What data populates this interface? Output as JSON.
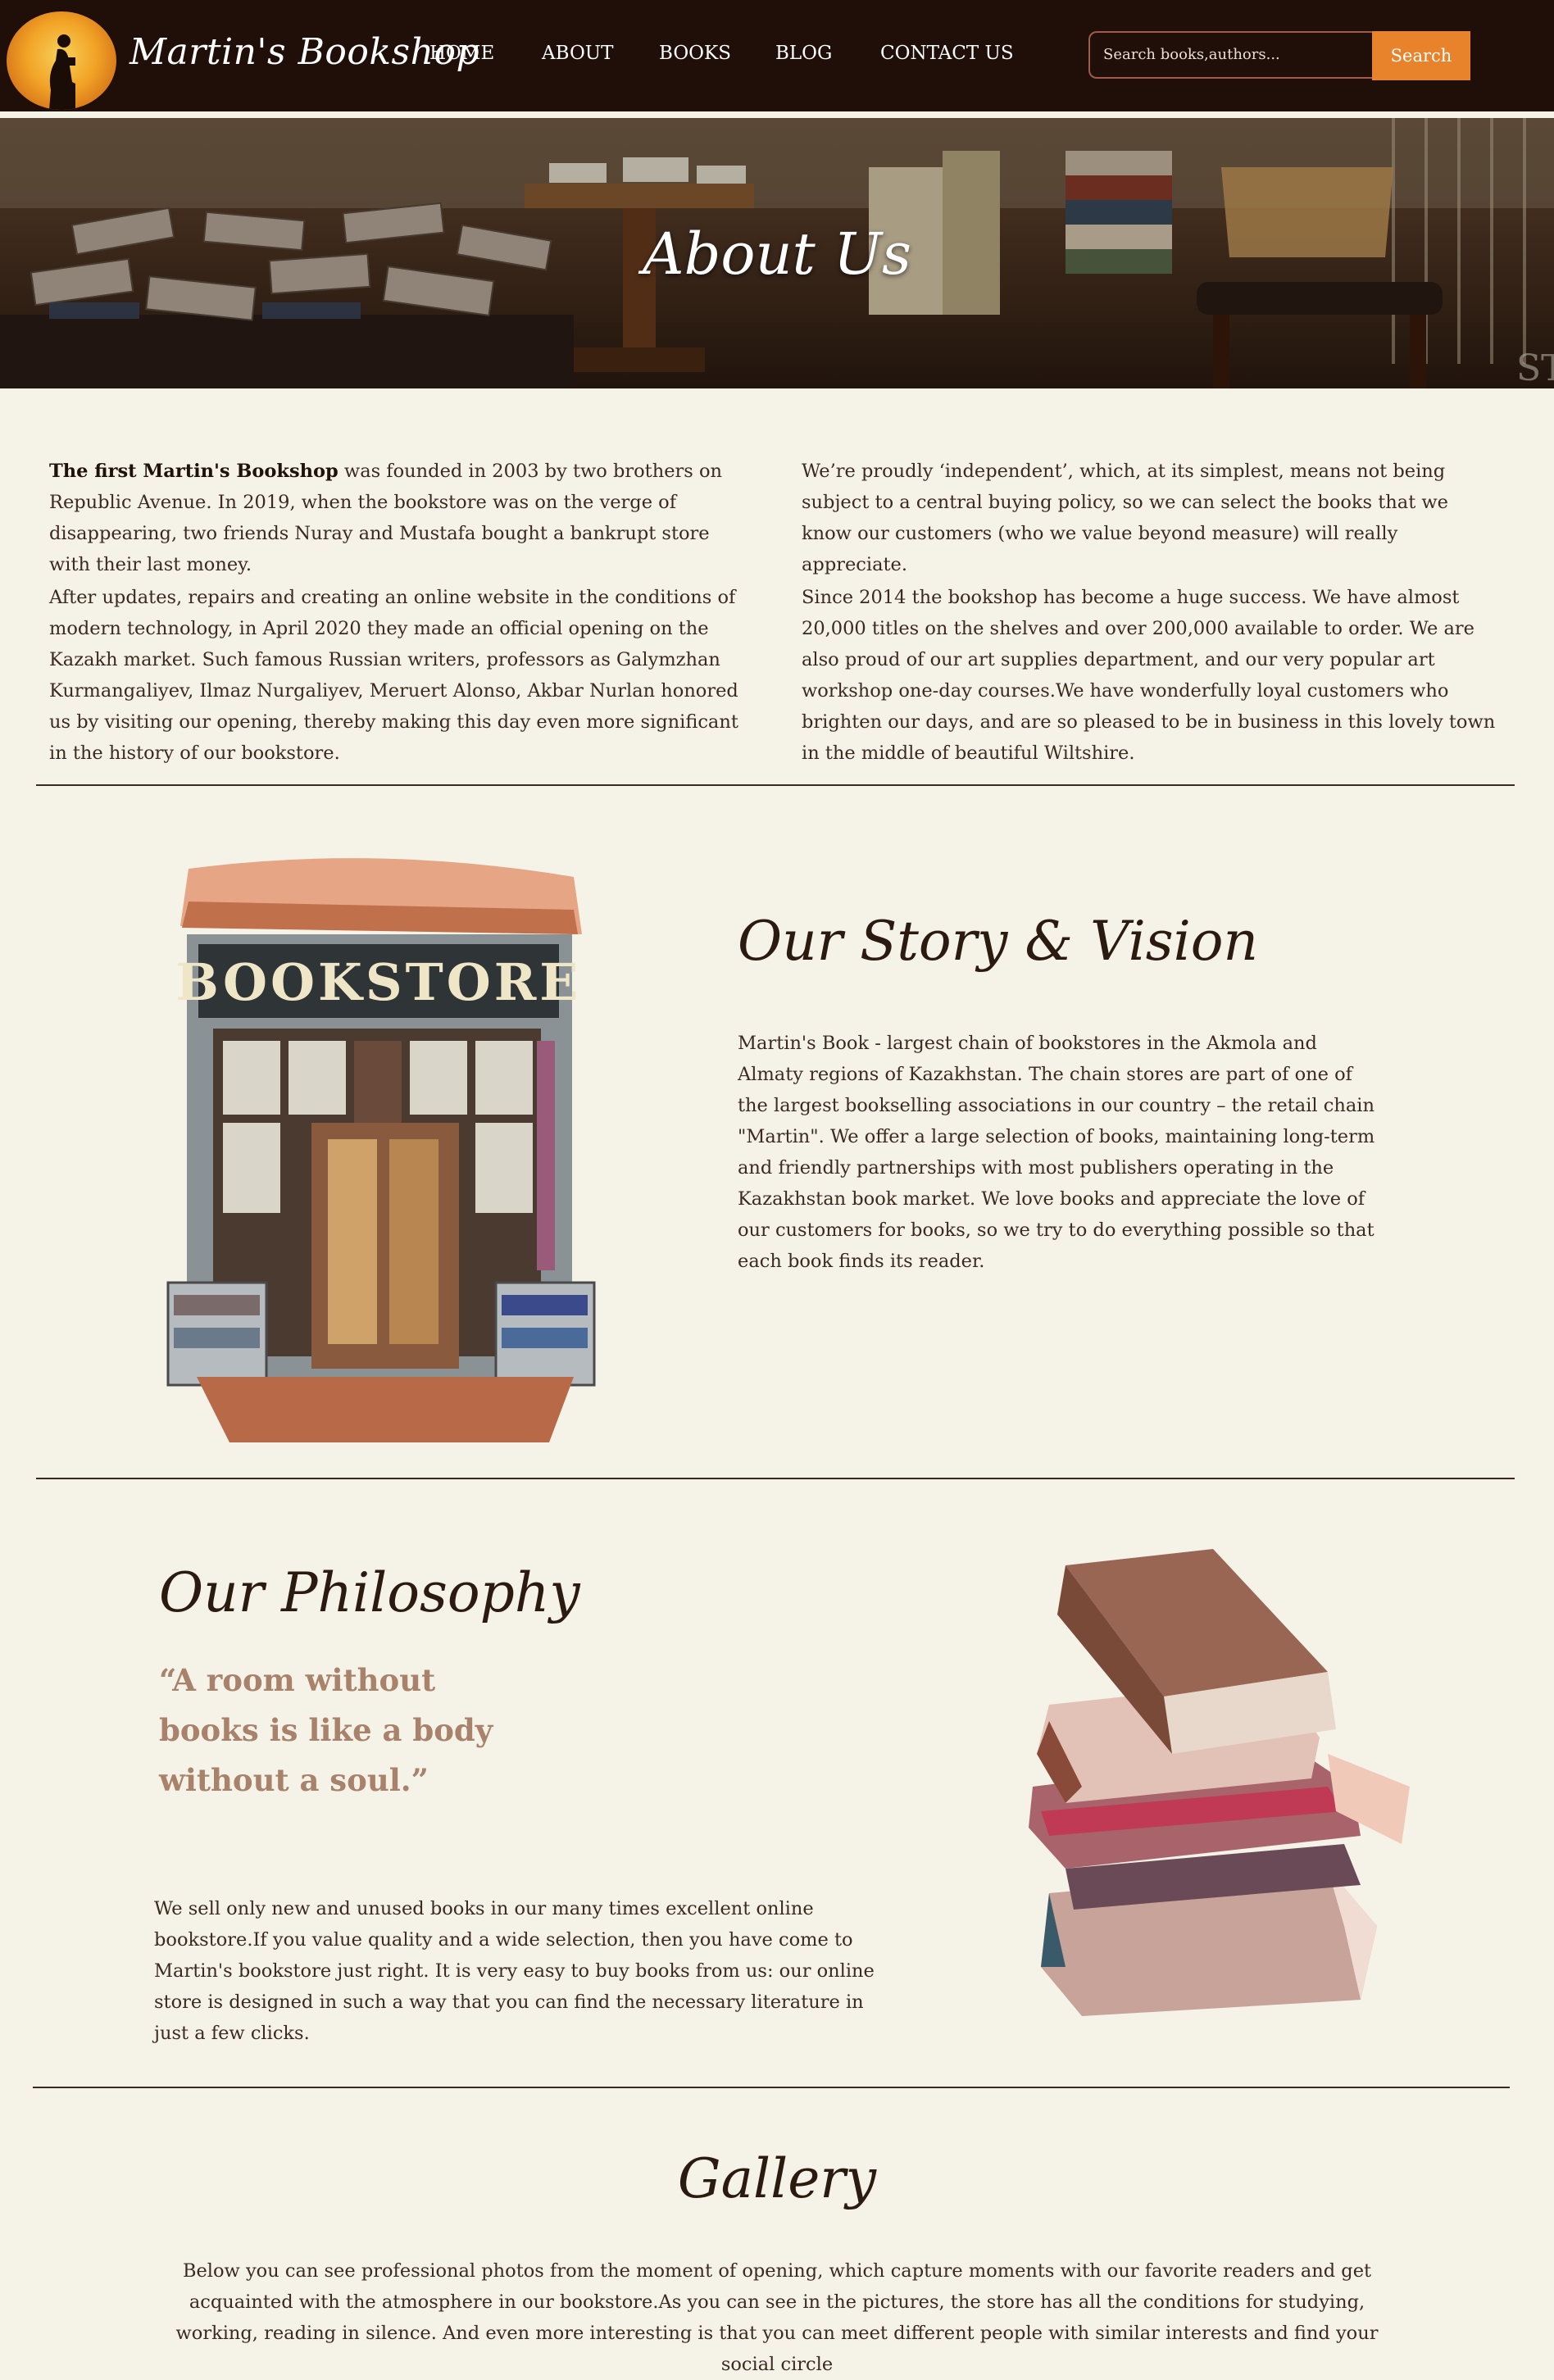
{
  "nav": {
    "brand": "Martin's Bookshop",
    "items": [
      "HOME",
      "ABOUT",
      "BOOKS",
      "BLOG",
      "CONTACT US"
    ],
    "search_placeholder": "Search books,authors...",
    "search_button": "Search"
  },
  "hero": {
    "title": "About Us"
  },
  "intro": {
    "left_lead": "The first Martin's Bookshop",
    "left_p1": " was founded in 2003 by two brothers on Republic Avenue. In 2019, when the bookstore was on the verge of disappearing, two friends Nuray and Mustafa bought a bankrupt store with their last money.",
    "left_p2": "After updates, repairs and creating an online website in the conditions of modern technology, in April 2020 they made an official opening on the Kazakh market. Such famous Russian writers, professors as Galymzhan Kurmangaliyev, Ilmaz Nurgaliyev, Meruert Alonso, Akbar Nurlan honored us by visiting our opening, thereby making this day even more significant in the history of our bookstore.",
    "right_p1": "We’re proudly ‘independent’, which, at its simplest, means not being subject to a central buying policy, so we can select the books that we know our customers (who we value beyond measure) will really appreciate.",
    "right_p2": "Since 2014 the bookshop has become a huge success. We have almost 20,000 titles on the shelves and over 200,000 available to order. We are also proud of our art supplies department, and our very popular art workshop one-day courses.We have wonderfully loyal customers who brighten our days, and are so pleased to be in business in this lovely town in the middle of beautiful Wiltshire."
  },
  "story": {
    "title": "Our Story & Vision",
    "sign": "BOOKSTORE",
    "text": "Martin's Book - largest chain of bookstores in the Akmola and Almaty regions of Kazakhstan. The chain stores are part of one of the largest bookselling associations in our country – the retail chain \"Martin\". We offer a large selection of books, maintaining long-term and friendly partnerships with most publishers operating in the Kazakhstan book market. We love books and appreciate the love of our customers for books, so we try to do everything possible so that each book finds its reader."
  },
  "philosophy": {
    "title": "Our Philosophy",
    "quote": "“A room without books is like a body without a soul.”",
    "text": "We sell only new and unused books in our many times excellent online bookstore.If you value quality and a wide selection, then you have come to Martin's bookstore just right. It is very easy to buy books from us: our online store is designed in such a way that you can find the necessary literature in just a few clicks."
  },
  "gallery": {
    "title": "Gallery",
    "text": "Below you can see professional photos from the moment of opening, which capture moments with our favorite readers and get acquainted with the atmosphere in our bookstore.As you can see in the pictures, the store has all the conditions for studying, working, reading in silence. And even more interesting is that you can meet different people with similar interests and find your social circle"
  },
  "colors": {
    "nav_bg": "#1f0f08",
    "accent": "#e8832c",
    "page_bg": "#f5f2e8",
    "quote": "#a8826a"
  }
}
